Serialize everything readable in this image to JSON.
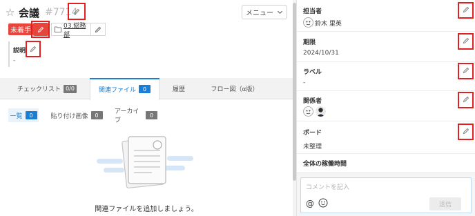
{
  "header": {
    "star_icon": "star-outline-icon",
    "title": "会議",
    "ticket_number": "#7714",
    "menu_label": "メニュー"
  },
  "status": {
    "label": "未着手",
    "color": "#e8453c"
  },
  "category": {
    "label": "03.総務部"
  },
  "description": {
    "label": "説明",
    "value": "-"
  },
  "tabs": [
    {
      "label": "チェックリスト",
      "count": "0/0"
    },
    {
      "label": "関連ファイル",
      "count": "0"
    },
    {
      "label": "履歴"
    },
    {
      "label": "フロー図（α版）"
    }
  ],
  "subtabs": [
    {
      "label": "一覧",
      "count": "0"
    },
    {
      "label": "貼り付け画像",
      "count": "0"
    },
    {
      "label": "アーカイブ",
      "count": "0"
    }
  ],
  "empty_state": {
    "message": "関連ファイルを追加しましょう。"
  },
  "sidebar": {
    "assignee": {
      "label": "担当者",
      "name": "鈴木 里英"
    },
    "due": {
      "label": "期限",
      "value": "2024/10/31"
    },
    "labels": {
      "label": "ラベル",
      "value": "-"
    },
    "members": {
      "label": "関係者"
    },
    "board": {
      "label": "ボード",
      "value": "未整理"
    },
    "worktime": {
      "label": "全体の稼働時間"
    }
  },
  "comment": {
    "placeholder": "コメントを記入",
    "at_symbol": "@",
    "send_label": "送信"
  },
  "colors": {
    "accent": "#1a7fd4",
    "highlight_box": "#e02020"
  }
}
